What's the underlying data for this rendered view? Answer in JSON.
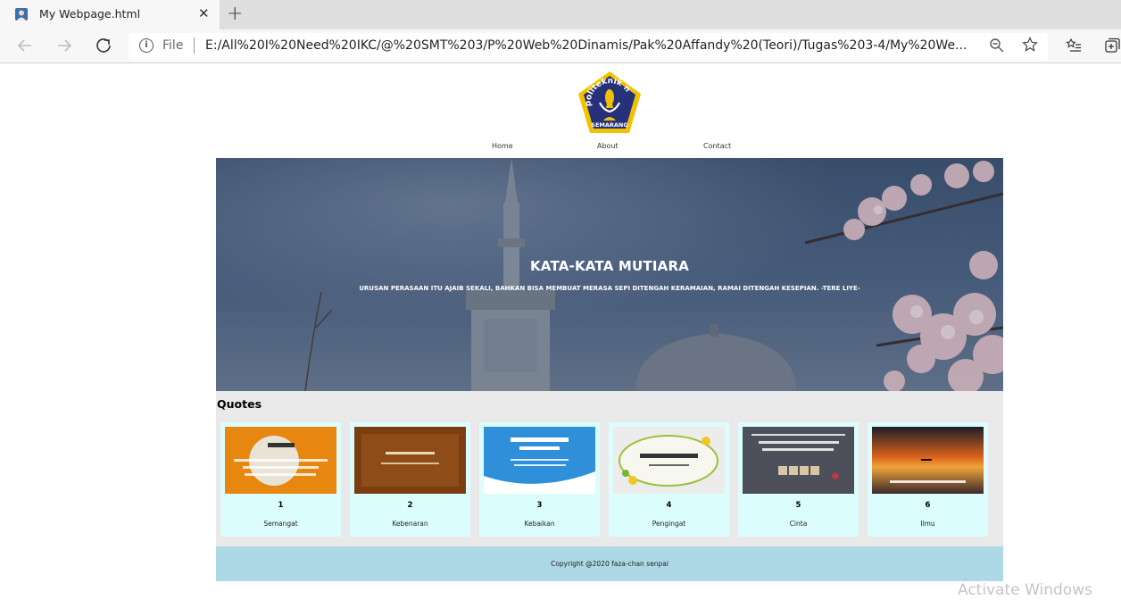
{
  "browser": {
    "tab_title": "My Webpage.html",
    "close_glyph": "✕",
    "newtab_glyph": "+",
    "scheme_label": "File",
    "url": "E:/All%20I%20Need%20IKC/@%20SMT%203/P%20Web%20Dinamis/Pak%20Affandy%20(Teori)/Tugas%203-4/My%20We...",
    "icons": [
      "back-icon",
      "forward-icon",
      "reload-icon",
      "info-icon",
      "zoom-icon",
      "favorite-star-icon",
      "favorites-list-icon",
      "collections-icon"
    ]
  },
  "page": {
    "logo_text": "politeknik negeri SEMARANG",
    "nav": [
      "Home",
      "About",
      "Contact"
    ],
    "hero_title": "KATA-KATA MUTIARA",
    "hero_subtitle": "URUSAN PERASAAN ITU AJAIB SEKALI, BAHKAN BISA MEMBUAT MERASA SEPI DITENGAH KERAMAIAN, RAMAI DITENGAH KESEPIAN. -TERE LIYE-",
    "quotes_heading": "Quotes",
    "cards": [
      {
        "num": "1",
        "label": "Semangat"
      },
      {
        "num": "2",
        "label": "Kebenaran"
      },
      {
        "num": "3",
        "label": "Kebaikan"
      },
      {
        "num": "4",
        "label": "Pengingat"
      },
      {
        "num": "5",
        "label": "Cinta"
      },
      {
        "num": "6",
        "label": "Ilmu"
      }
    ],
    "footer": "Copyright @2020 faza-chan senpai"
  },
  "os": {
    "watermark": "Activate Windows"
  },
  "colors": {
    "quotes_bg": "#e9e9e9",
    "card_bg": "#dcfdfd",
    "footer_bg": "#add8e6"
  }
}
